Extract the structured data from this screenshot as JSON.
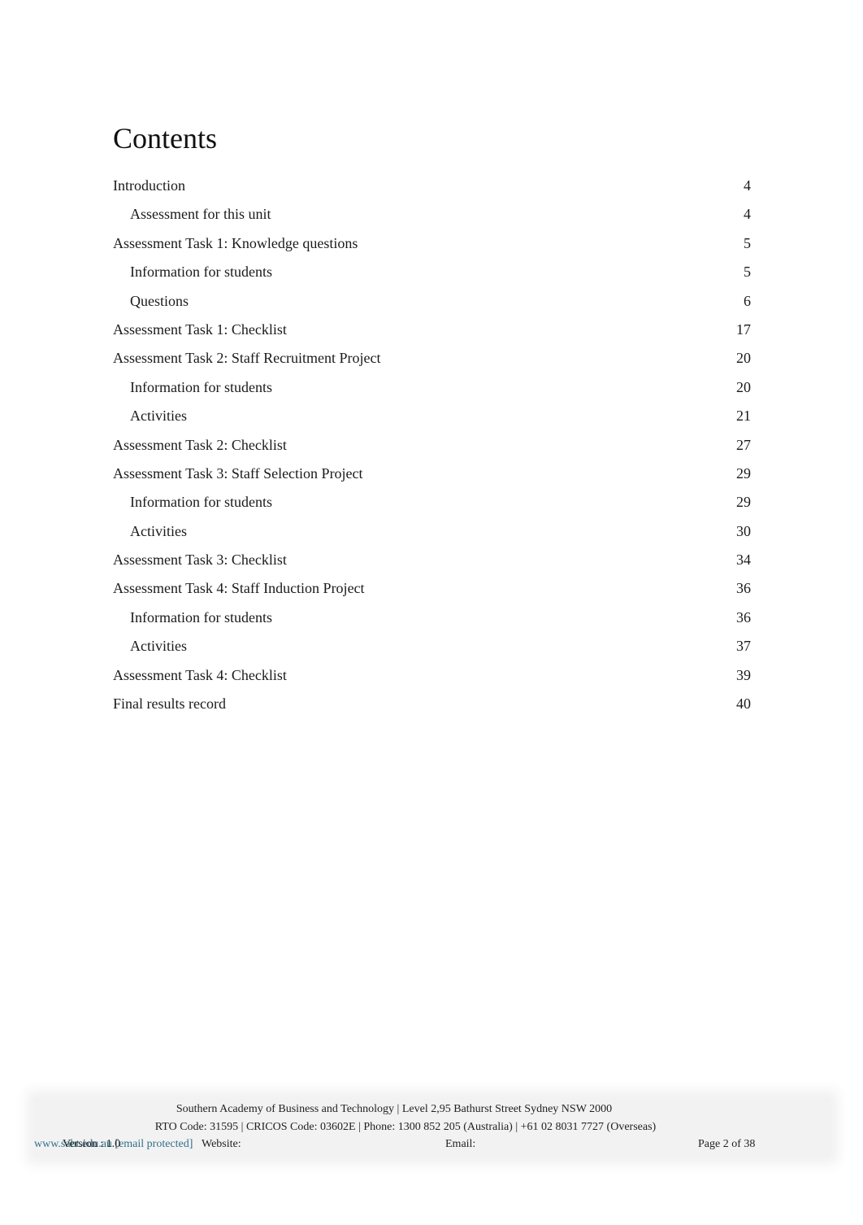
{
  "document": {
    "title": "Contents"
  },
  "toc": {
    "entries": [
      {
        "label": "Introduction",
        "page": "4",
        "level": 1
      },
      {
        "label": "Assessment for this unit",
        "page": "4",
        "level": 2
      },
      {
        "label": "Assessment Task 1: Knowledge questions",
        "page": "5",
        "level": 1
      },
      {
        "label": "Information for students",
        "page": "5",
        "level": 2
      },
      {
        "label": "Questions",
        "page": "6",
        "level": 2
      },
      {
        "label": "Assessment Task 1: Checklist",
        "page": "17",
        "level": 1
      },
      {
        "label": "Assessment Task 2: Staff Recruitment Project",
        "page": "20",
        "level": 1
      },
      {
        "label": "Information for students",
        "page": "20",
        "level": 2
      },
      {
        "label": "Activities",
        "page": "21",
        "level": 2
      },
      {
        "label": "Assessment Task 2: Checklist",
        "page": "27",
        "level": 1
      },
      {
        "label": "Assessment Task 3: Staff Selection Project",
        "page": "29",
        "level": 1
      },
      {
        "label": "Information for students",
        "page": "29",
        "level": 2
      },
      {
        "label": "Activities",
        "page": "30",
        "level": 2
      },
      {
        "label": "Assessment Task 3: Checklist",
        "page": "34",
        "level": 1
      },
      {
        "label": "Assessment Task 4: Staff Induction Project",
        "page": "36",
        "level": 1
      },
      {
        "label": "Information for students",
        "page": "36",
        "level": 2
      },
      {
        "label": "Activities",
        "page": "37",
        "level": 2
      },
      {
        "label": "Assessment Task 4: Checklist",
        "page": "39",
        "level": 1
      },
      {
        "label": "Final results record",
        "page": "40",
        "level": 1
      }
    ]
  },
  "footer": {
    "address_line": "Southern Academy of Business and Technology | Level 2,95 Bathurst Street Sydney NSW 2000",
    "codes_line": "RTO Code: 31595 | CRICOS Code: 03602E | Phone: 1300 852 205 (Australia) | +61 02 8031 7727 (Overseas)",
    "version": "Version : 1.0",
    "website_label": "Website:",
    "website": "www.sabt.edu.au",
    "email_label": "Email:",
    "email": "[email protected]",
    "page_indicator": "Page 2 of 38",
    "link_color": "#31708a"
  }
}
